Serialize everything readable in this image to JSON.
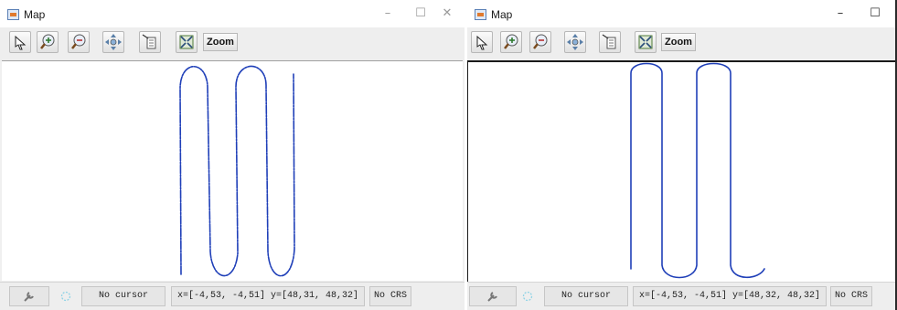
{
  "colors": {
    "track": "#1f3fb8",
    "window_bg": "#f0f0f0",
    "canvas_bg": "#ffffff"
  },
  "windows": [
    {
      "title": "Map",
      "controls": {
        "minimize": "–",
        "maximize": "☐",
        "close": "✕"
      },
      "toolbar": {
        "tools": [
          "pointer-icon",
          "zoom-in-icon",
          "zoom-out-icon",
          "pan-icon",
          "info-icon",
          "zoom-full-extent-icon"
        ],
        "zoom_label": "Zoom"
      },
      "status": {
        "tool_icon": "wrench-icon",
        "busy_icon": "spinner-icon",
        "cursor": "No cursor",
        "extent": "x=[-4,53, -4,51] y=[48,31, 48,32]",
        "crs": "No CRS"
      }
    },
    {
      "title": "Map",
      "controls": {
        "minimize": "–",
        "maximize": "☐"
      },
      "toolbar": {
        "tools": [
          "pointer-icon",
          "zoom-in-icon",
          "zoom-out-icon",
          "pan-icon",
          "info-icon",
          "zoom-full-extent-icon"
        ],
        "zoom_label": "Zoom"
      },
      "status": {
        "tool_icon": "wrench-icon",
        "busy_icon": "spinner-icon",
        "cursor": "No cursor",
        "extent": "x=[-4,53, -4,51] y=[48,32, 48,32]",
        "crs": "No CRS"
      }
    }
  ]
}
